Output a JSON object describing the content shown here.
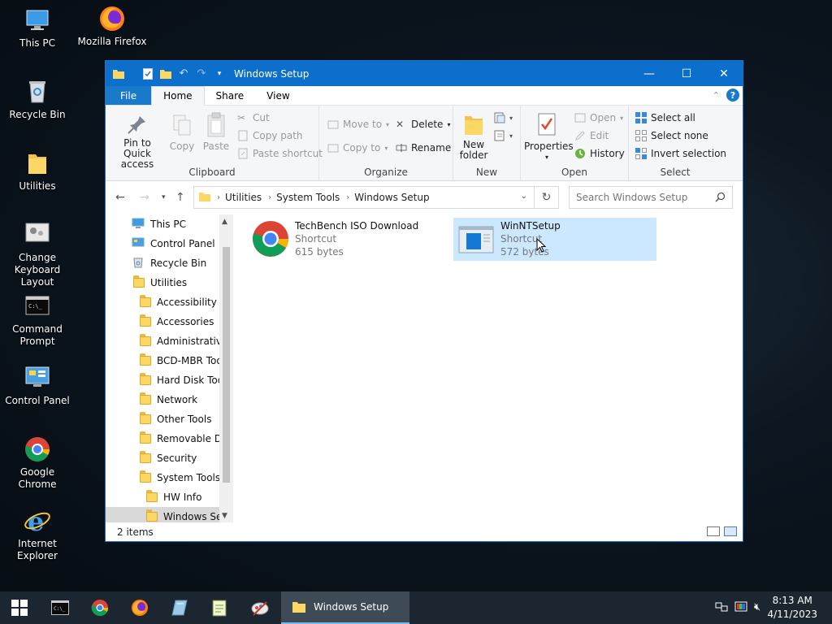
{
  "desktop": {
    "icons": [
      {
        "label": "This PC"
      },
      {
        "label": "Mozilla Firefox"
      },
      {
        "label": "Recycle Bin"
      },
      {
        "label": "Utilities"
      },
      {
        "label": "Change Keyboard Layout"
      },
      {
        "label": "Command Prompt"
      },
      {
        "label": "Control Panel"
      },
      {
        "label": "Google Chrome"
      },
      {
        "label": "Internet Explorer"
      }
    ]
  },
  "window": {
    "title": "Windows Setup",
    "accent": "#0b6fcb",
    "ribbon_tabs": {
      "file": "File",
      "home": "Home",
      "share": "Share",
      "view": "View"
    },
    "help": "?",
    "clipboard": {
      "pin": "Pin to Quick access",
      "copy": "Copy",
      "paste": "Paste",
      "cut": "Cut",
      "copy_path": "Copy path",
      "paste_shortcut": "Paste shortcut",
      "label": "Clipboard"
    },
    "organize": {
      "move_to": "Move to",
      "copy_to": "Copy to",
      "delete": "Delete",
      "rename": "Rename",
      "label": "Organize"
    },
    "new": {
      "new_folder": "New folder",
      "label": "New"
    },
    "open": {
      "properties": "Properties",
      "open": "Open",
      "edit": "Edit",
      "history": "History",
      "label": "Open"
    },
    "select": {
      "select_all": "Select all",
      "select_none": "Select none",
      "invert": "Invert selection",
      "label": "Select"
    },
    "address": {
      "crumbs": [
        "Utilities",
        "System Tools",
        "Windows Setup"
      ]
    },
    "search": {
      "placeholder": "Search Windows Setup"
    },
    "nav_tree": [
      {
        "label": "This PC",
        "icon": "this-pc-icon"
      },
      {
        "label": "Control Panel",
        "icon": "control-panel-icon"
      },
      {
        "label": "Recycle Bin",
        "icon": "recycle-bin-icon"
      },
      {
        "label": "Utilities",
        "icon": "folder-icon"
      },
      {
        "label": "Accessibility",
        "icon": "folder-icon"
      },
      {
        "label": "Accessories",
        "icon": "folder-icon"
      },
      {
        "label": "Administrative",
        "icon": "folder-icon"
      },
      {
        "label": "BCD-MBR Tool",
        "icon": "folder-icon"
      },
      {
        "label": "Hard Disk Tools",
        "icon": "folder-icon"
      },
      {
        "label": "Network",
        "icon": "folder-icon"
      },
      {
        "label": "Other Tools",
        "icon": "folder-icon"
      },
      {
        "label": "Removable Dri",
        "icon": "folder-icon"
      },
      {
        "label": "Security",
        "icon": "folder-icon"
      },
      {
        "label": "System Tools",
        "icon": "folder-icon"
      },
      {
        "label": "HW Info",
        "icon": "folder-icon"
      },
      {
        "label": "Windows Setu",
        "icon": "folder-icon"
      }
    ],
    "files": [
      {
        "name": "TechBench ISO Download",
        "type": "Shortcut",
        "size": "615 bytes",
        "icon": "chrome-icon"
      },
      {
        "name": "WinNTSetup",
        "type": "Shortcut",
        "size": "572 bytes",
        "icon": "winntsetup-icon"
      }
    ],
    "status": "2 items"
  },
  "taskbar": {
    "active_window": "Windows Setup",
    "time": "8:13 AM",
    "date": "4/11/2023"
  }
}
